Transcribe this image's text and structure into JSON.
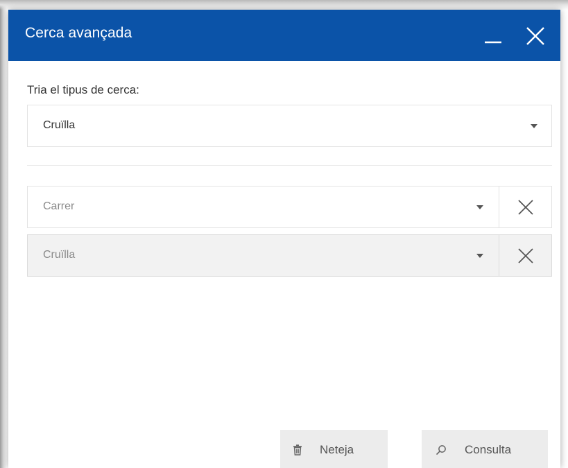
{
  "dialog": {
    "title": "Cerca avançada",
    "header_color": "#0b53a8"
  },
  "search_type": {
    "label": "Tria el tipus de cerca:",
    "selected": "Cruïlla"
  },
  "fields": {
    "street_placeholder": "Carrer",
    "crossing_placeholder": "Cruïlla"
  },
  "actions": {
    "clear_label": "Neteja",
    "query_label": "Consulta"
  },
  "icons": {
    "minimize": "minimize-icon",
    "close": "close-icon",
    "clear_field": "close-icon",
    "dropdown": "chevron-down-icon",
    "trash": "trash-icon",
    "search": "search-icon"
  }
}
